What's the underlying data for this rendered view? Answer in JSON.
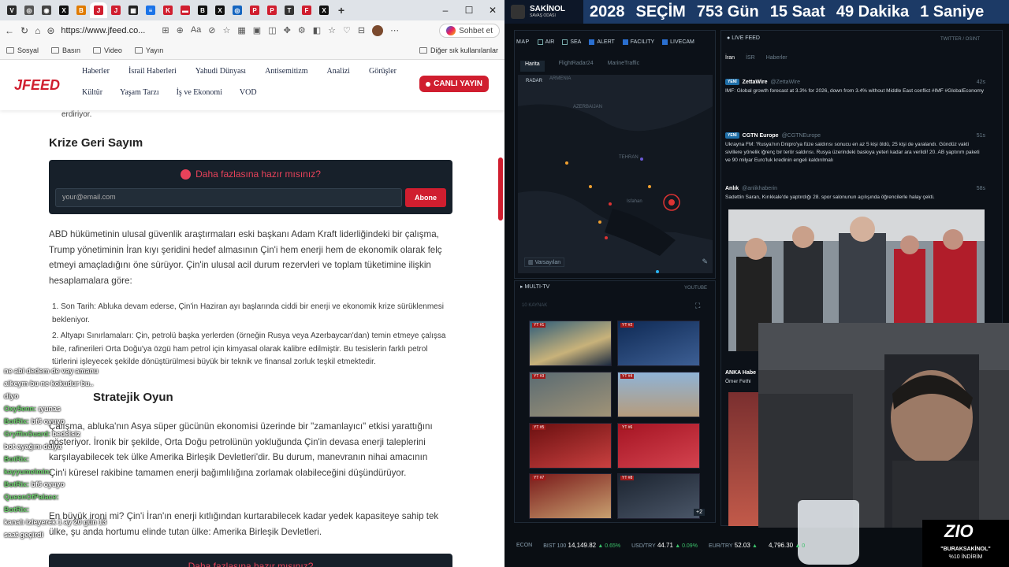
{
  "browser": {
    "tabs": [
      {
        "icon": "V",
        "color": "#2a2a2a"
      },
      {
        "icon": "◎",
        "color": "#555"
      },
      {
        "icon": "◉",
        "color": "#444"
      },
      {
        "icon": "X",
        "color": "#111"
      },
      {
        "icon": "B",
        "color": "#e07b00"
      },
      {
        "icon": "J",
        "color": "#d01e2f",
        "active": true
      },
      {
        "icon": "J",
        "color": "#d01e2f"
      },
      {
        "icon": "▦",
        "color": "#222"
      },
      {
        "icon": "≡",
        "color": "#1a73e8"
      },
      {
        "icon": "K",
        "color": "#d01e2f"
      },
      {
        "icon": "▬",
        "color": "#d01e2f"
      },
      {
        "icon": "B",
        "color": "#111"
      },
      {
        "icon": "X",
        "color": "#111"
      },
      {
        "icon": "◎",
        "color": "#1565c0"
      },
      {
        "icon": "P",
        "color": "#d01e2f"
      },
      {
        "icon": "P",
        "color": "#d01e2f"
      },
      {
        "icon": "T",
        "color": "#333"
      },
      {
        "icon": "F",
        "color": "#d01e2f"
      },
      {
        "icon": "X",
        "color": "#111"
      }
    ],
    "url": "https://www.jfeed.co...",
    "chat_button": "Sohbet et",
    "bookmarks": [
      "Sosyal",
      "Basın",
      "Video",
      "Yayın"
    ],
    "bookmarks_other": "Diğer sık kullanılanlar"
  },
  "site": {
    "logo": "JFEED",
    "nav_row1": [
      "Haberler",
      "İsrail Haberleri",
      "Yahudi Dünyası",
      "Antisemitizm",
      "Analizi",
      "Görüşler"
    ],
    "nav_row2": [
      "Kültür",
      "Yaşam Tarzı",
      "İş ve Ekonomi",
      "VOD"
    ],
    "live_button": "CANLI YAYIN"
  },
  "article": {
    "fragment_top": "erdiriyor.",
    "heading1": "Krize Geri Sayım",
    "newsletter": {
      "title": "Daha fazlasına hazır mısınız?",
      "placeholder": "your@email.com",
      "button": "Abone"
    },
    "para1": "ABD hükümetinin ulusal güvenlik araştırmaları eski başkanı Adam Kraft liderliğindeki bir çalışma, Trump yönetiminin İran kıyı şeridini hedef almasının Çin'i hem enerji hem de ekonomik olarak felç etmeyi amaçladığını öne sürüyor. Çin'in ulusal acil durum rezervleri ve toplam tüketimine ilişkin hesaplamalara göre:",
    "list": [
      "1. Son Tarih: Abluka devam ederse, Çin'in Haziran ayı başlarında ciddi bir enerji ve ekonomik krize sürüklenmesi bekleniyor.",
      "2. Altyapı Sınırlamaları: Çin, petrolü başka yerlerden (örneğin Rusya veya Azerbaycan'dan) temin etmeye çalışsa bile, rafinerileri Orta Doğu'ya özgü ham petrol için kimyasal olarak kalibre edilmiştir. Bu tesislerin farklı petrol türlerini işleyecek şekilde dönüştürülmesi büyük bir teknik ve finansal zorluk teşkil etmektedir."
    ],
    "heading2": "Stratejik Oyun",
    "para2": "Çalışma, abluka'nın Asya süper gücünün ekonomisi üzerinde bir \"zamanlayıcı\" etkisi yarattığını gösteriyor. İronik bir şekilde, Orta Doğu petrolünün yokluğunda Çin'in devasa enerji taleplerini karşılayabilecek tek ülke Amerika Birleşik Devletleri'dir. Bu durum, manevranın nihai amacının Çin'i küresel rakibine tamamen enerji bağımlılığına zorlamak olabileceğini düşündürüyor.",
    "para3": "En büyük ironi mi? Çin'i İran'ın enerji kıtlığından kurtarabilecek kadar yedek kapasiteye sahip tek ülke, şu anda hortumu elinde tutan ülke: Amerika Birleşik Devletleri.",
    "newsletter2_title": "Daha fazlasına hazır mısınız?"
  },
  "chat": [
    {
      "user": "",
      "text": "ne abi dedem de vay amanu"
    },
    {
      "user": "",
      "text": "aikeym bu ne kokudur bu.."
    },
    {
      "user": "",
      "text": "diyo"
    },
    {
      "user": "Oxy5enn:",
      "text": "ıyunas"
    },
    {
      "user": "BotRix:",
      "text": "bf6 oyuyo"
    },
    {
      "user": "GryffinGuard:",
      "text": "bedelsiz"
    },
    {
      "user": "",
      "text": "bot ayağını dalya"
    },
    {
      "user": "BotRix:",
      "text": ""
    },
    {
      "user": "kayyumelmin:",
      "text": ""
    },
    {
      "user": "BotRix:",
      "text": "bf6 oyuyo"
    },
    {
      "user": "QueenOfPalace:",
      "text": ""
    },
    {
      "user": "BotRix:",
      "text": ""
    },
    {
      "user": "",
      "text": "kanalı izleyerek 1 ay 20 gün 13"
    },
    {
      "user": "",
      "text": "saat geçirdi"
    }
  ],
  "stream": {
    "brand": "SAKİNOL",
    "brand_sub": "SAVAŞ ODASI",
    "countdown": [
      "2028",
      "SEÇİM",
      "753 Gün",
      "15 Saat",
      "49 Dakika",
      "1 Saniye"
    ],
    "map_label": "MAP",
    "map_layers": [
      {
        "label": "AIR",
        "on": false
      },
      {
        "label": "SEA",
        "on": false
      },
      {
        "label": "ALERT",
        "on": true
      },
      {
        "label": "FACILITY",
        "on": true
      },
      {
        "label": "LIVECAM",
        "on": true
      }
    ],
    "map_tabs": [
      "Harita",
      "FlightRadar24",
      "MarineTraffic"
    ],
    "map_labels": [
      "RADAR",
      "ARMENIA",
      "AZERBAIJAN",
      "TEHRAN",
      "Isfahan",
      "Varsayılan"
    ],
    "multitv": "MULTI-TV",
    "multitv_count": "10 KAYNAK",
    "youtube": "YOUTUBE",
    "tv_tags": [
      "YT #1",
      "YT #2",
      "YT #3",
      "YT #4",
      "YT #5",
      "YT #6",
      "YT #7",
      "YT #8"
    ],
    "tv_more": "+2",
    "live_feed": "LIVE FEED",
    "feed_source": "TWITTER / OSINT",
    "feed_tabs": [
      "İran",
      "İSR",
      "Haberler"
    ],
    "feed": [
      {
        "badge": "YENİ",
        "name": "ZettaWire",
        "handle": "@ZettaWire",
        "time": "42s",
        "text": "IMF: Global growth forecast at 3.3% for 2026, down from 3.4% without Middle East conflict #IMF #GlobalEconomy"
      },
      {
        "badge": "YENİ",
        "name": "CGTN Europe",
        "handle": "@CGTNEurope",
        "time": "51s",
        "text": "Ukrayna FM: 'Rusya'nın Dnipro'ya füze saldırısı sonucu en az 5 kişi öldü, 25 kişi de yaralandı. Gündüz vakti sivillere yönelik iğrenç bir terör saldırısı. Rusya üzerindeki baskıya yeteri kadar ara verildi! 20. AB yaptırım paketi ve 90 milyar Euro'luk kredinin engeli kaldırılmalı"
      },
      {
        "badge": "",
        "name": "Anlık",
        "handle": "@anlikhaberin",
        "time": "58s",
        "text": "Sadettin Saran, Kırıkkale'de yaptırdığı 28. spor salonunun açılışında öğrencilerle halay çekti."
      },
      {
        "badge": "",
        "name": "ANKA Habe",
        "handle": "",
        "time": "",
        "text": "Ömer Fethi"
      }
    ],
    "ticker_label": "ECON",
    "ticker": [
      {
        "name": "BIST 100",
        "value": "14,149.82",
        "change": "▲ 0.65%"
      },
      {
        "name": "USD/TRY",
        "value": "44.71",
        "change": "▲ 0.09%"
      },
      {
        "name": "EUR/TRY",
        "value": "52.03",
        "change": "▲"
      },
      {
        "name": "",
        "value": "4,796.30",
        "change": "▲ 0"
      }
    ],
    "promo_logo": "ZIO",
    "promo_code": "\"BURAKSAKİNOL\"",
    "promo_discount": "%10 İNDİRİM"
  }
}
